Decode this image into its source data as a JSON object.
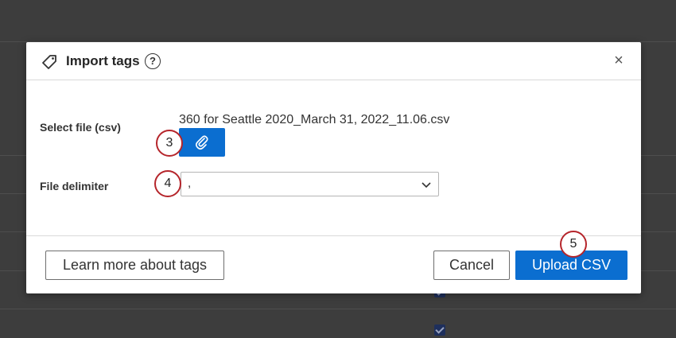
{
  "modal": {
    "title": "Import tags",
    "help_label": "?",
    "close_label": "×"
  },
  "form": {
    "select_file_label": "Select file (csv)",
    "file_name": "360 for Seattle 2020_March 31, 2022_11.06.csv",
    "file_delimiter_label": "File delimiter",
    "file_delimiter_value": ","
  },
  "footer": {
    "learn_more_label": "Learn more about tags",
    "cancel_label": "Cancel",
    "upload_label": "Upload CSV"
  },
  "steps": {
    "step3": "3",
    "step4": "4",
    "step5": "5"
  },
  "colors": {
    "primary": "#0b6ed0",
    "step_ring": "#b5252b",
    "overlay": "#3d3d3d"
  },
  "icons": {
    "tag": "tag-icon",
    "help": "help-icon",
    "close": "close-icon",
    "attach": "paperclip-icon",
    "chevron": "chevron-down-icon"
  }
}
